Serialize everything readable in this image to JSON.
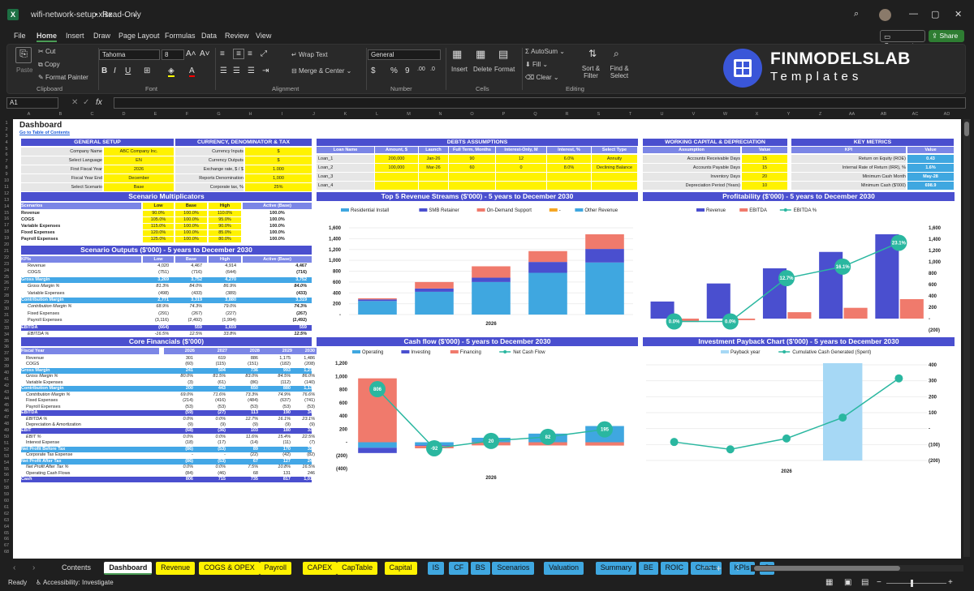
{
  "window": {
    "filename": "wifi-network-setup.xlsx",
    "separator": "•",
    "mode": "Read-Only"
  },
  "menu": [
    "File",
    "Home",
    "Insert",
    "Draw",
    "Page Layout",
    "Formulas",
    "Data",
    "Review",
    "View"
  ],
  "top_actions": {
    "comments": "Comments",
    "share": "Share"
  },
  "ribbon": {
    "clipboard": {
      "paste": "Paste",
      "cut": "Cut",
      "copy": "Copy",
      "format_painter": "Format Painter",
      "label": "Clipboard"
    },
    "font": {
      "name": "Tahoma",
      "size": "8",
      "label": "Font"
    },
    "alignment": {
      "wrap": "Wrap Text",
      "merge": "Merge & Center",
      "label": "Alignment"
    },
    "number": {
      "format": "General",
      "label": "Number"
    },
    "cells": {
      "insert": "Insert",
      "delete": "Delete",
      "format": "Format",
      "label": "Cells"
    },
    "editing": {
      "autosum": "AutoSum",
      "fill": "Fill",
      "clear": "Clear",
      "sort": "Sort & Filter",
      "find": "Find & Select",
      "label": "Editing"
    },
    "brand": {
      "name": "FINMODELSLAB",
      "sub": "Templates"
    }
  },
  "formula_bar": {
    "cell_ref": "A1",
    "fx": "fx"
  },
  "columns": [
    "A",
    "B",
    "C",
    "D",
    "E",
    "F",
    "G",
    "H",
    "I",
    "J",
    "K",
    "L",
    "M",
    "N",
    "O",
    "P",
    "Q",
    "R",
    "S",
    "T",
    "U",
    "V",
    "W",
    "X",
    "Y",
    "Z",
    "AA",
    "AB",
    "AC",
    "AD"
  ],
  "sheet": {
    "title": "Dashboard",
    "link": "Go to Table of Contents",
    "general_setup": {
      "header": "GENERAL SETUP",
      "rows": [
        [
          "Company Name",
          "ABC Company Inc."
        ],
        [
          "Select Language",
          "EN"
        ],
        [
          "First Fiscal Year",
          "2026"
        ],
        [
          "Fiscal Year End",
          "December"
        ],
        [
          "Select Scenario",
          "Base"
        ]
      ]
    },
    "currency": {
      "header": "CURRENCY, DENOMINATOR & TAX",
      "rows": [
        [
          "Currency Inputs",
          "$"
        ],
        [
          "Currency Outputs",
          "$"
        ],
        [
          "Exchange rate, $ / $",
          "1.000"
        ],
        [
          "Reports Denomination",
          "1,000"
        ],
        [
          "Corporate tax, %",
          "25%"
        ]
      ]
    },
    "debts": {
      "header": "DEBTS ASSUMPTIONS",
      "cols": [
        "Loan Name",
        "Amount, $",
        "Launch",
        "Full Term, Months",
        "Interest-Only, M",
        "Interest, %",
        "Select Type"
      ],
      "rows": [
        [
          "Loan_1",
          "200,000",
          "Jan-26",
          "90",
          "12",
          "6.0%",
          "Annuity"
        ],
        [
          "Loan_2",
          "100,000",
          "Mar-26",
          "60",
          "0",
          "8.0%",
          "Declining Balance"
        ],
        [
          "Loan_3",
          "",
          "",
          "",
          "",
          "",
          ""
        ],
        [
          "Loan_4",
          "",
          "",
          "",
          "",
          "",
          ""
        ]
      ]
    },
    "wc": {
      "header": "WORKING CAPITAL & DEPRECIATION",
      "cols": [
        "Assumption",
        "Value"
      ],
      "rows": [
        [
          "Accounts Receivable Days",
          "15"
        ],
        [
          "Accounts Payable Days",
          "15"
        ],
        [
          "Inventory Days",
          "20"
        ],
        [
          "Depreciation Period (Years)",
          "10"
        ]
      ]
    },
    "kpi": {
      "header": "KEY METRICS",
      "cols": [
        "KPI",
        "Value"
      ],
      "rows": [
        [
          "Return on Equity (ROE)",
          "0.43"
        ],
        [
          "Internal Rate of Return (IRR), %",
          "1.6%"
        ],
        [
          "Minimum Cash Month",
          "May-28"
        ],
        [
          "Minimum Cash ($'000)",
          "698.9"
        ]
      ]
    },
    "multipliers": {
      "header": "Scenario Multiplicators",
      "cols": [
        "Scenarios",
        "Low",
        "Base",
        "High",
        "Active (Base)"
      ],
      "rows": [
        [
          "Revenue",
          "90.0%",
          "100.0%",
          "110.0%",
          "100.0%"
        ],
        [
          "COGS",
          "105.0%",
          "100.0%",
          "95.0%",
          "100.0%"
        ],
        [
          "Variable Expenses",
          "115.0%",
          "100.0%",
          "90.0%",
          "100.0%"
        ],
        [
          "Fixed Expenses",
          "120.0%",
          "100.0%",
          "85.0%",
          "100.0%"
        ],
        [
          "Payroll Expenses",
          "125.0%",
          "100.0%",
          "80.0%",
          "100.0%"
        ]
      ]
    },
    "scen_out": {
      "header": "Scenario Outputs ($'000) - 5 years to December 2030",
      "cols": [
        "KPIs",
        "Low",
        "Base",
        "High",
        "Active (Base)"
      ],
      "rows": [
        [
          "Revenue",
          "4,020",
          "4,467",
          "4,914",
          "4,467",
          "n"
        ],
        [
          "COGS",
          "(751)",
          "(716)",
          "(644)",
          "(716)",
          "n"
        ],
        [
          "Gross Margin",
          "3,269",
          "3,752",
          "4,270",
          "3,752",
          "b"
        ],
        [
          "Gross Margin %",
          "81.3%",
          "84.0%",
          "86.9%",
          "84.0%",
          "i"
        ],
        [
          "Variable Expenses",
          "(498)",
          "(433)",
          "(389)",
          "(433)",
          "n"
        ],
        [
          "Contribution Margin",
          "2,771",
          "3,319",
          "3,880",
          "3,319",
          "b"
        ],
        [
          "Contribution Margin %",
          "68.9%",
          "74.3%",
          "79.0%",
          "74.3%",
          "i"
        ],
        [
          "Fixed Expenses",
          "(291)",
          "(267)",
          "(227)",
          "(267)",
          "n"
        ],
        [
          "Payroll Expenses",
          "(3,116)",
          "(2,492)",
          "(1,994)",
          "(2,492)",
          "n"
        ],
        [
          "EBITDA",
          "(664)",
          "559",
          "1,659",
          "559",
          "b"
        ],
        [
          "EBITDA %",
          "-16.5%",
          "12.5%",
          "33.8%",
          "12.5%",
          "i"
        ]
      ]
    },
    "core": {
      "header": "Core Financials ($'000)",
      "cols": [
        "Fiscal Year",
        "2026",
        "2027",
        "2028",
        "2029",
        "2030"
      ],
      "rows": [
        [
          "Revenue",
          "301",
          "619",
          "886",
          "1,175",
          "1,486",
          "n"
        ],
        [
          "COGS",
          "(60)",
          "(115)",
          "(151)",
          "(182)",
          "(208)",
          "n"
        ],
        [
          "Gross Margin",
          "241",
          "504",
          "736",
          "993",
          "1,278",
          "b"
        ],
        [
          "Gross Margin %",
          "80.0%",
          "81.5%",
          "83.0%",
          "84.5%",
          "86.0%",
          "i"
        ],
        [
          "Variable Expenses",
          "(3)",
          "(61)",
          "(86)",
          "(112)",
          "(140)",
          "n"
        ],
        [
          "Contribution Margin",
          "200",
          "443",
          "650",
          "880",
          "1,138",
          "b"
        ],
        [
          "Contribution Margin %",
          "69.0%",
          "71.6%",
          "73.3%",
          "74.9%",
          "76.6%",
          "i"
        ],
        [
          "Fixed Expenses",
          "(214)",
          "(416)",
          "(484)",
          "(637)",
          "(741)",
          "n"
        ],
        [
          "Payroll Expenses",
          "(53)",
          "(53)",
          "(53)",
          "(53)",
          "(53)",
          "n"
        ],
        [
          "EBITDA",
          "(59)",
          "(27)",
          "113",
          "190",
          "343",
          "b"
        ],
        [
          "EBITDA %",
          "0.0%",
          "0.0%",
          "12.7%",
          "16.1%",
          "23.1%",
          "i"
        ],
        [
          "Depreciation & Amortization",
          "(9)",
          "(9)",
          "(9)",
          "(9)",
          "(9)",
          "n"
        ],
        [
          "EBIT",
          "(68)",
          "(36)",
          "103",
          "180",
          "334",
          "b"
        ],
        [
          "EBIT %",
          "0.0%",
          "0.0%",
          "11.6%",
          "15.4%",
          "22.5%",
          "i"
        ],
        [
          "Interest Expense",
          "(18)",
          "(17)",
          "(14)",
          "(11)",
          "(7)",
          "n"
        ],
        [
          "Net Profit Before Tax",
          "(86)",
          "(53)",
          "89",
          "170",
          "327",
          "b"
        ],
        [
          "Corporate Tax Expense",
          "-",
          "-",
          "(22)",
          "(42)",
          "(82)",
          "n"
        ],
        [
          "Net Profit After Tax",
          "(86)",
          "(53)",
          "67",
          "127",
          "245",
          "b"
        ],
        [
          "Net Profit After Tax %",
          "0.0%",
          "0.0%",
          "7.5%",
          "10.8%",
          "16.5%",
          "i"
        ],
        [
          "Operating Cash Flows",
          "(84)",
          "(46)",
          "68",
          "131",
          "246",
          "n"
        ],
        [
          "Cash",
          "806",
          "715",
          "735",
          "817",
          "1,012",
          "b"
        ]
      ]
    }
  },
  "chart_data": [
    {
      "type": "bar",
      "title": "Top 5 Revenue Streams ($'000) - 5 years to December 2030",
      "categories": [
        "2026",
        "2027",
        "2028",
        "2029",
        "2030"
      ],
      "ylim": [
        0,
        1600
      ],
      "series": [
        {
          "name": "Residential Install",
          "values": [
            250,
            420,
            600,
            770,
            960
          ],
          "color": "#3fa7e0"
        },
        {
          "name": "SMB Retainer",
          "values": [
            30,
            60,
            80,
            200,
            250
          ],
          "color": "#4a4fcf"
        },
        {
          "name": "On-Demand Support",
          "values": [
            20,
            120,
            210,
            200,
            270
          ],
          "color": "#f07a6c"
        },
        {
          "name": "-",
          "values": [
            0,
            0,
            0,
            0,
            0
          ],
          "color": "#f5a623"
        },
        {
          "name": "Other Revenue",
          "values": [
            0,
            0,
            0,
            0,
            0
          ],
          "color": "#3fa7e0"
        }
      ],
      "yticks": [
        "1,600",
        "1,400",
        "1,200",
        "1,000",
        "800",
        "600",
        "400",
        "200",
        "-"
      ]
    },
    {
      "type": "bar",
      "title": "Profitability ($'000) - 5 years to December 2030",
      "categories": [
        "2026",
        "2027",
        "2028",
        "2029",
        "2030"
      ],
      "ylim": [
        -200,
        1600
      ],
      "series": [
        {
          "name": "Revenue",
          "values": [
            301,
            619,
            886,
            1175,
            1486
          ],
          "color": "#4a4fcf"
        },
        {
          "name": "EBITDA",
          "values": [
            -59,
            -27,
            113,
            190,
            343
          ],
          "color": "#f07a6c"
        },
        {
          "name": "EBITDA %",
          "values": [
            0.0,
            0.0,
            12.7,
            16.1,
            23.1
          ],
          "color": "#2ab7a0"
        }
      ],
      "labels": [
        "0.0%",
        "0.0%",
        "12.7%",
        "16.1%",
        "23.1%"
      ],
      "yticks": [
        "1,600",
        "1,400",
        "1,200",
        "1,000",
        "800",
        "600",
        "400",
        "200",
        "-",
        "(200)"
      ]
    },
    {
      "type": "bar",
      "title": "Cash flow ($'000) - 5 years to December 2030",
      "categories": [
        "2026",
        "2027",
        "2028",
        "2029",
        "2030"
      ],
      "ylim": [
        -400,
        1200
      ],
      "series": [
        {
          "name": "Operating",
          "values": [
            -84,
            -46,
            68,
            131,
            246
          ],
          "color": "#3fa7e0"
        },
        {
          "name": "Investing",
          "values": [
            -80,
            -10,
            0,
            0,
            0
          ],
          "color": "#4a4fcf"
        },
        {
          "name": "Financing",
          "values": [
            970,
            -36,
            -48,
            -49,
            -51
          ],
          "color": "#f07a6c"
        },
        {
          "name": "Net Cash Flow",
          "values": [
            806,
            -92,
            20,
            82,
            195
          ],
          "color": "#2ab7a0"
        }
      ],
      "labels": [
        "806",
        "-92",
        "20",
        "82",
        "195"
      ],
      "yticks": [
        "1,200",
        "1,000",
        "800",
        "600",
        "400",
        "200",
        "-",
        "(200)",
        "(400)"
      ]
    },
    {
      "type": "bar",
      "title": "Investment Payback Chart ($'000) - 5 years to December 2030",
      "categories": [
        "2026",
        "2027",
        "2028",
        "2029",
        "2030"
      ],
      "series": [
        {
          "name": "Payback year",
          "values": [
            0,
            0,
            0,
            1,
            0
          ],
          "color": "#a6d8f5"
        },
        {
          "name": "Cumulative Cash Generated (Spent)",
          "values": [
            -84,
            -130,
            -62,
            69,
            315
          ],
          "color": "#2ab7a0"
        }
      ],
      "yticks": [
        "400",
        "300",
        "200",
        "100",
        "-",
        "(100)",
        "(200)"
      ]
    }
  ],
  "sheet_tabs": [
    [
      "Contents",
      "n"
    ],
    [
      "Dashboard",
      "a"
    ],
    [
      "Revenue",
      "y"
    ],
    [
      "COGS & OPEX",
      "y"
    ],
    [
      "Payroll",
      "y"
    ],
    [
      "CAPEX",
      "y"
    ],
    [
      "CapTable",
      "y"
    ],
    [
      "Capital",
      "y"
    ],
    [
      "IS",
      "b"
    ],
    [
      "CF",
      "b"
    ],
    [
      "BS",
      "b"
    ],
    [
      "Scenarios",
      "b"
    ],
    [
      "Valuation",
      "b"
    ],
    [
      "Summary",
      "b"
    ],
    [
      "BE",
      "b"
    ],
    [
      "ROIC",
      "b"
    ],
    [
      "Charts",
      "b"
    ],
    [
      "KPIs",
      "b"
    ],
    [
      "S",
      "b"
    ]
  ],
  "status": {
    "ready": "Ready",
    "accessibility": "Accessibility: Investigate"
  }
}
